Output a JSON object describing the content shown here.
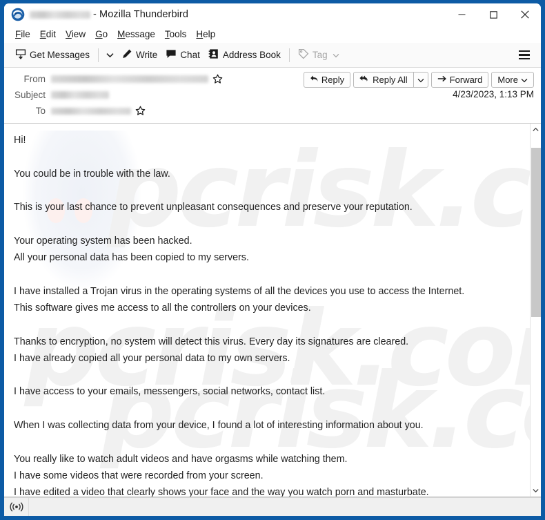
{
  "window": {
    "app_icon": "thunderbird-icon",
    "title_redacted": "",
    "title_suffix": "- Mozilla Thunderbird",
    "controls": {
      "minimize": "minimize-icon",
      "maximize": "maximize-icon",
      "close": "close-icon"
    }
  },
  "menubar": {
    "items": [
      {
        "label": "File",
        "accel": "F"
      },
      {
        "label": "Edit",
        "accel": "E"
      },
      {
        "label": "View",
        "accel": "V"
      },
      {
        "label": "Go",
        "accel": "G"
      },
      {
        "label": "Message",
        "accel": "M"
      },
      {
        "label": "Tools",
        "accel": "T"
      },
      {
        "label": "Help",
        "accel": "H"
      }
    ]
  },
  "toolbar": {
    "get_messages": "Get Messages",
    "write": "Write",
    "chat": "Chat",
    "address_book": "Address Book",
    "tag": "Tag",
    "tag_disabled": true,
    "app_menu": "hamburger-icon"
  },
  "message_header": {
    "from_label": "From",
    "from_value": "",
    "subject_label": "Subject",
    "subject_value": "",
    "to_label": "To",
    "to_value": "",
    "date": "4/23/2023, 1:13 PM",
    "actions": {
      "reply": "Reply",
      "reply_all": "Reply All",
      "forward": "Forward",
      "more": "More"
    }
  },
  "message_body": {
    "text": "Hi!\n\nYou could be in trouble with the law.\n\nThis is your last chance to prevent unpleasant consequences and preserve your reputation.\n\nYour operating system has been hacked.\nAll your personal data has been copied to my servers.\n\nI have installed a Trojan virus in the operating systems of all the devices you use to access the Internet.\nThis software gives me access to all the controllers on your devices.\n\nThanks to encryption, no system will detect this virus. Every day its signatures are cleared.\nI have already copied all your personal data to my own servers.\n\nI have access to your emails, messengers, social networks, contact list.\n\nWhen I was collecting data from your device, I found a lot of interesting information about you.\n\nYou really like to watch adult videos and have orgasms while watching them.\nI have some videos that were recorded from your screen.\nI have edited a video that clearly shows your face and the way you watch porn and masturbate.\nYour family and friends will have no problem recognizing you in this video. This video will be able to completely\ndestroy your reputation.\n\nAlso on your device I was able to find data that is not allowed to be stored in your country.\nYou could be in trouble with the law.\n\n\n\nI can send out proof of your illegal activities to all your contacts, make it public to everyone on the internet.",
    "watermark": "pcrisk.com"
  },
  "statusbar": {
    "online_icon": "online-status-icon",
    "text": ""
  },
  "colors": {
    "window_border": "#0d5ba5",
    "toolbar_bg": "#fafafa",
    "body_text": "#222222",
    "label_text": "#5a5a5a",
    "scrollbar_thumb": "#c8c8c8",
    "statusbar_bg": "#f0f0f0"
  }
}
